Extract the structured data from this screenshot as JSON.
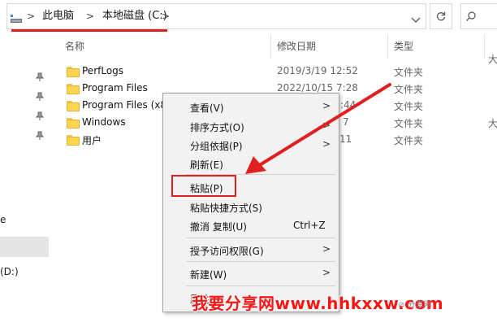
{
  "address_bar": {
    "path": [
      "此电脑",
      "本地磁盘 (C:)"
    ],
    "chevron": ">"
  },
  "nav": {
    "dropdown_icon": "chevron-down-icon",
    "refresh_icon": "refresh-icon"
  },
  "header": {
    "name": "名称",
    "date": "修改日期",
    "type": "类型"
  },
  "left_pane": {
    "partial_label": "e",
    "drive_label": "(D:)"
  },
  "files": [
    {
      "name": "PerfLogs",
      "date": "2019/3/19 12:52",
      "type": "文件夹"
    },
    {
      "name": "Program Files",
      "date": "2022/10/15 7:28",
      "type": "文件夹"
    },
    {
      "name": "Program Files (x8",
      "date": ":44",
      "type": "文件夹"
    },
    {
      "name": "Windows",
      "date": "7",
      "type": "文件夹"
    },
    {
      "name": "用户",
      "date": "11",
      "type": "文件夹"
    }
  ],
  "partial_size": "大",
  "context_menu": {
    "view": "查看(V)",
    "sort": "排序方式(O)",
    "group": "分组依据(P)",
    "refresh": "刷新(E)",
    "paste": "粘贴(P)",
    "paste_shortcut": "粘贴快捷方式(S)",
    "undo": "撤消 复制(U)",
    "undo_shortcut": "Ctrl+Z",
    "access": "授予访问权限(G)",
    "new": "新建(W)",
    "properties": "属性(R)",
    "submenu_arrow": ">"
  },
  "watermark": {
    "text": "我要分享网www.hhkxxw.com",
    "small": "⊘ 分享网"
  },
  "colors": {
    "highlight_red": "#e02020",
    "folder_yellow": "#ffd54f",
    "menu_bg": "#f2f2f2"
  }
}
